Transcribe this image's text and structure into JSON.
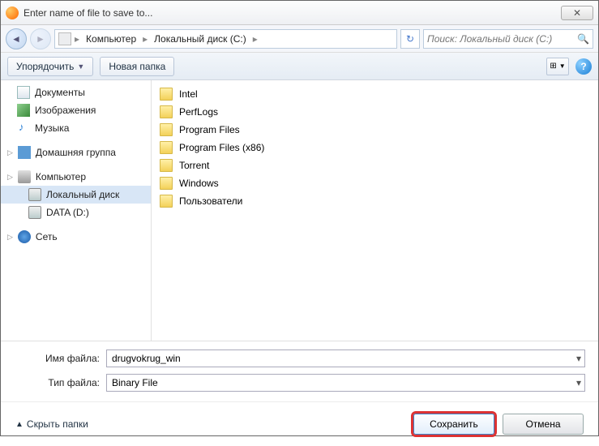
{
  "titlebar": {
    "title": "Enter name of file to save to..."
  },
  "nav": {
    "breadcrumb": [
      "Компьютер",
      "Локальный диск (C:)"
    ],
    "search_placeholder": "Поиск: Локальный диск (C:)"
  },
  "toolbar": {
    "organize": "Упорядочить",
    "new_folder": "Новая папка"
  },
  "tree": {
    "libs": [
      {
        "label": "Документы",
        "icon": "doc"
      },
      {
        "label": "Изображения",
        "icon": "img"
      },
      {
        "label": "Музыка",
        "icon": "music"
      }
    ],
    "homegroup": {
      "label": "Домашняя группа"
    },
    "computer": {
      "label": "Компьютер",
      "children": [
        {
          "label": "Локальный диск",
          "icon": "drive",
          "selected": true
        },
        {
          "label": "DATA (D:)",
          "icon": "drive"
        }
      ]
    },
    "network": {
      "label": "Сеть"
    }
  },
  "files": [
    {
      "name": "Intel"
    },
    {
      "name": "PerfLogs"
    },
    {
      "name": "Program Files"
    },
    {
      "name": "Program Files (x86)"
    },
    {
      "name": "Torrent"
    },
    {
      "name": "Windows"
    },
    {
      "name": "Пользователи"
    }
  ],
  "fields": {
    "filename_label": "Имя файла:",
    "filetype_label": "Тип файла:",
    "filename_value": "drugvokrug_win",
    "filetype_value": "Binary File"
  },
  "footer": {
    "hide_folders": "Скрыть папки",
    "save": "Сохранить",
    "cancel": "Отмена"
  }
}
